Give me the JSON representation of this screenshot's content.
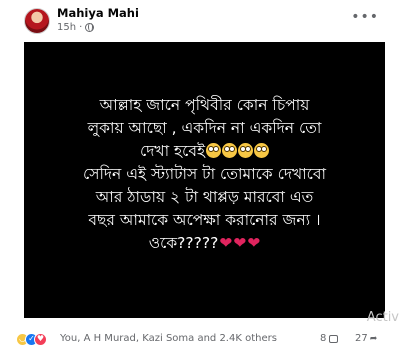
{
  "post": {
    "author": "Mahiya Mahi",
    "time": "15h",
    "privacy_icon": "globe-icon",
    "more_icon": "more-options-icon",
    "text_lines": [
      "আল্লাহ জানে পৃথিবীর কোন চিপায়",
      "লুকায় আছো , একদিন না একদিন তো",
      "দেখা হবেই",
      "সেদিন এই স্ট্যাটাস টা তোমাকে দেখাবো",
      "আর ঠাডায় ২ টা থাপ্পড় মারবো এত",
      "বছর আমাকে অপেক্ষা করানোর জন্য ।",
      "ওকে?????"
    ],
    "emoji_line3": "flushed-face-emoji x4",
    "emoji_line7": "red-heart-emoji x3",
    "background_color": "#000000",
    "text_color": "#ffffff"
  },
  "footer": {
    "reaction_icons": [
      "haha-icon",
      "like-icon",
      "love-icon"
    ],
    "reaction_names": "You, A H Murad, Kazi Soma and 2.4K others",
    "comment_count": "8",
    "share_count": "27",
    "watermark": "Activ"
  },
  "colors": {
    "brand": "#1877f2",
    "meta_text": "#65676b"
  }
}
